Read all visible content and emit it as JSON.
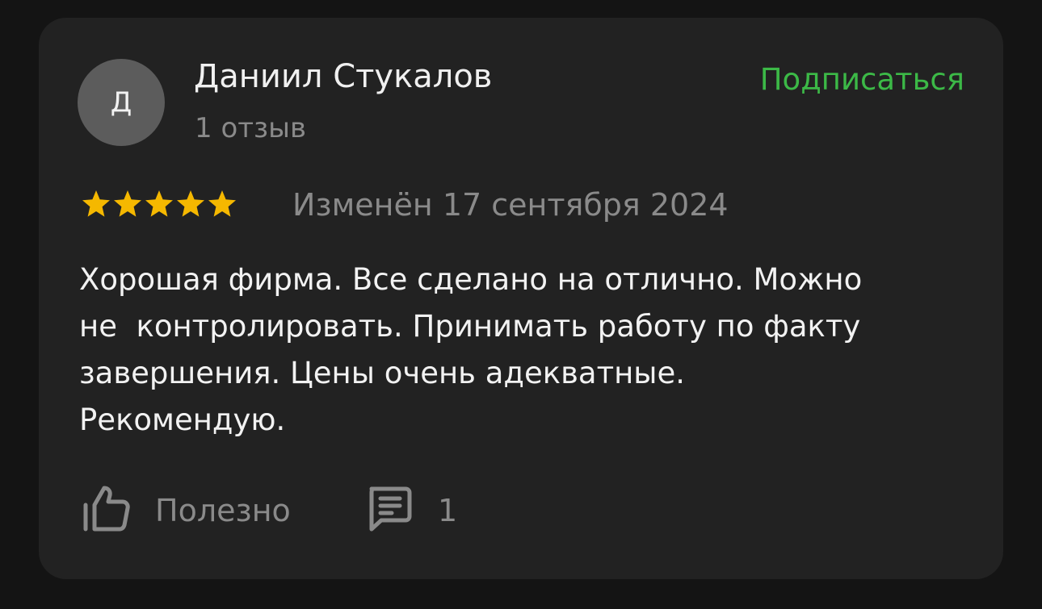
{
  "review": {
    "author": {
      "initial": "Д",
      "name": "Даниил Стукалов",
      "reviews_count": "1 отзыв"
    },
    "subscribe_label": "Подписаться",
    "rating": 5,
    "rating_max": 5,
    "date": "Изменён 17 сентября 2024",
    "text": "Хорошая фирма. Все сделано на отлично. Можно\nне  контролировать. Принимать работу по факту\nзавершения. Цены очень адекватные.\nРекомендую.",
    "helpful_label": "Полезно",
    "comments_count": "1"
  },
  "icons": {
    "helpful": "thumbs-up-icon",
    "comments": "comment-icon",
    "rating": "star-icon"
  },
  "colors": {
    "background": "#141414",
    "card": "#222222",
    "accent": "#3cb947",
    "star": "#f5b800",
    "muted_text": "#8a8a8a",
    "primary_text": "#f2f2f2",
    "avatar": "#5c5c5c"
  }
}
